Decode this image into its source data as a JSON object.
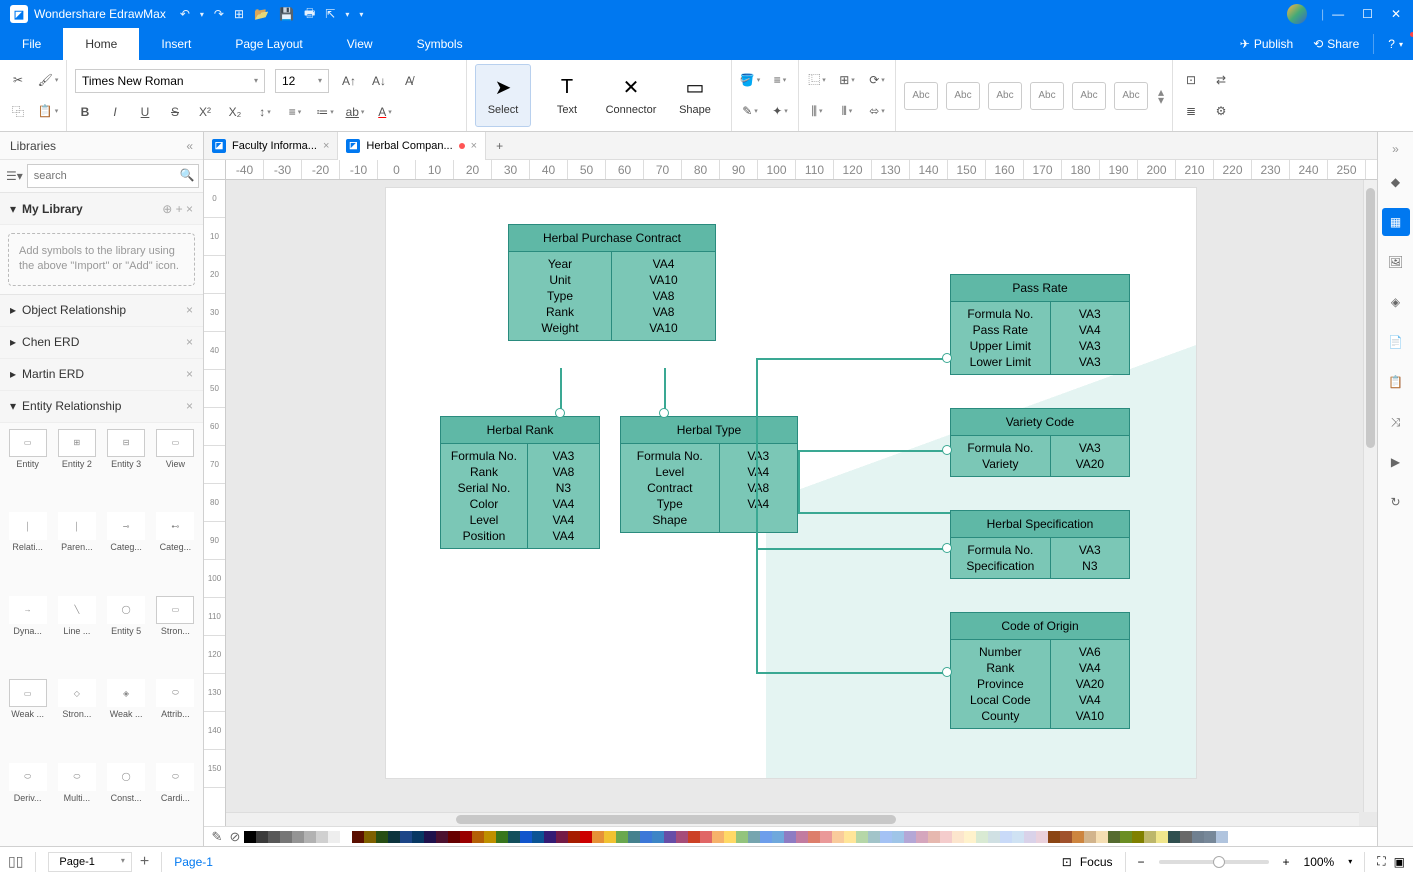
{
  "app": {
    "name": "Wondershare EdrawMax"
  },
  "menu": {
    "tabs": [
      "File",
      "Home",
      "Insert",
      "Page Layout",
      "View",
      "Symbols"
    ],
    "active": 1,
    "publish": "Publish",
    "share": "Share"
  },
  "ribbon": {
    "font": "Times New Roman",
    "size": "12",
    "tools": {
      "select": "Select",
      "text": "Text",
      "connector": "Connector",
      "shape": "Shape"
    }
  },
  "swatchLabel": "Abc",
  "libraries": {
    "title": "Libraries",
    "search_ph": "search",
    "mylib": {
      "title": "My Library",
      "hint": "Add symbols to the library using the above \"Import\" or \"Add\" icon."
    },
    "sections": [
      "Object Relationship",
      "Chen ERD",
      "Martin ERD",
      "Entity Relationship"
    ],
    "shapes": [
      "Entity",
      "Entity 2",
      "Entity 3",
      "View",
      "Relati...",
      "Paren...",
      "Categ...",
      "Categ...",
      "Dyna...",
      "Line ...",
      "Entity 5",
      "Stron...",
      "Weak ...",
      "Stron...",
      "Weak ...",
      "Attrib...",
      "Deriv...",
      "Multi...",
      "Const...",
      "Cardi..."
    ]
  },
  "doctabs": [
    {
      "title": "Faculty Informa...",
      "modified": false,
      "active": false
    },
    {
      "title": "Herbal Compan...",
      "modified": true,
      "active": true
    }
  ],
  "ruler_h": [
    "-40",
    "-30",
    "-20",
    "-10",
    "0",
    "10",
    "20",
    "30",
    "40",
    "50",
    "60",
    "70",
    "80",
    "90",
    "100",
    "110",
    "120",
    "130",
    "140",
    "150",
    "160",
    "170",
    "180",
    "190",
    "200",
    "210",
    "220",
    "230",
    "240",
    "250"
  ],
  "ruler_v": [
    "0",
    "10",
    "20",
    "30",
    "40",
    "50",
    "60",
    "70",
    "80",
    "90",
    "100",
    "110",
    "120",
    "130",
    "140",
    "150"
  ],
  "entities": {
    "purchase": {
      "title": "Herbal Purchase Contract",
      "left": [
        "Year",
        "Unit",
        "Type",
        "Rank",
        "Weight"
      ],
      "right": [
        "VA4",
        "VA10",
        "VA8",
        "VA8",
        "VA10"
      ]
    },
    "rank": {
      "title": "Herbal Rank",
      "left": [
        "Formula No.",
        "Rank",
        "Serial No.",
        "Color",
        "Level",
        "Position"
      ],
      "right": [
        "VA3",
        "VA8",
        "N3",
        "VA4",
        "VA4",
        "VA4"
      ]
    },
    "type": {
      "title": "Herbal Type",
      "left": [
        "Formula No.",
        "Level",
        "Contract",
        "Type",
        "Shape"
      ],
      "right": [
        "VA3",
        "VA4",
        "VA8",
        "VA4",
        ""
      ]
    },
    "passrate": {
      "title": "Pass Rate",
      "left": [
        "Formula No.",
        "Pass Rate",
        "Upper Limit",
        "Lower Limit"
      ],
      "right": [
        "VA3",
        "VA4",
        "VA3",
        "VA3"
      ]
    },
    "variety": {
      "title": "Variety Code",
      "left": [
        "Formula No.",
        "Variety"
      ],
      "right": [
        "VA3",
        "VA20"
      ]
    },
    "spec": {
      "title": "Herbal Specification",
      "left": [
        "Formula No.",
        "Specification"
      ],
      "right": [
        "VA3",
        "N3"
      ]
    },
    "origin": {
      "title": "Code of Origin",
      "left": [
        "Number",
        "Rank",
        "Province",
        "Local Code",
        "County"
      ],
      "right": [
        "VA6",
        "VA4",
        "VA20",
        "VA4",
        "VA10"
      ]
    }
  },
  "status": {
    "pagesel": "Page-1",
    "pagecur": "Page-1",
    "focus": "Focus",
    "zoom": "100%"
  },
  "colors": [
    "#000000",
    "#3b3b3b",
    "#585858",
    "#767676",
    "#949494",
    "#b2b2b2",
    "#d0d0d0",
    "#eeeeee",
    "#ffffff",
    "#5b0f00",
    "#7f6000",
    "#274e13",
    "#0c343d",
    "#1c4587",
    "#073763",
    "#20124d",
    "#4c1130",
    "#660000",
    "#990000",
    "#b45f06",
    "#bf9000",
    "#38761d",
    "#134f5c",
    "#1155cc",
    "#0b5394",
    "#351c75",
    "#741b47",
    "#a61c00",
    "#cc0000",
    "#e69138",
    "#f1c232",
    "#6aa84f",
    "#45818e",
    "#3c78d8",
    "#3d85c6",
    "#674ea7",
    "#a64d79",
    "#cc4125",
    "#e06666",
    "#f6b26b",
    "#ffd966",
    "#93c47d",
    "#76a5af",
    "#6d9eeb",
    "#6fa8dc",
    "#8e7cc3",
    "#c27ba0",
    "#dd7e6b",
    "#ea9999",
    "#f9cb9c",
    "#ffe599",
    "#b6d7a8",
    "#a2c4c9",
    "#a4c2f4",
    "#9fc5e8",
    "#b4a7d6",
    "#d5a6bd",
    "#e6b8af",
    "#f4cccc",
    "#fce5cd",
    "#fff2cc",
    "#d9ead3",
    "#d0e0e3",
    "#c9daf8",
    "#cfe2f3",
    "#d9d2e9",
    "#ead1dc",
    "#8b4513",
    "#a0522d",
    "#cd853f",
    "#d2b48c",
    "#f5deb3",
    "#556b2f",
    "#6b8e23",
    "#808000",
    "#bdb76b",
    "#f0e68c",
    "#2f4f4f",
    "#696969",
    "#708090",
    "#778899",
    "#b0c4de"
  ]
}
